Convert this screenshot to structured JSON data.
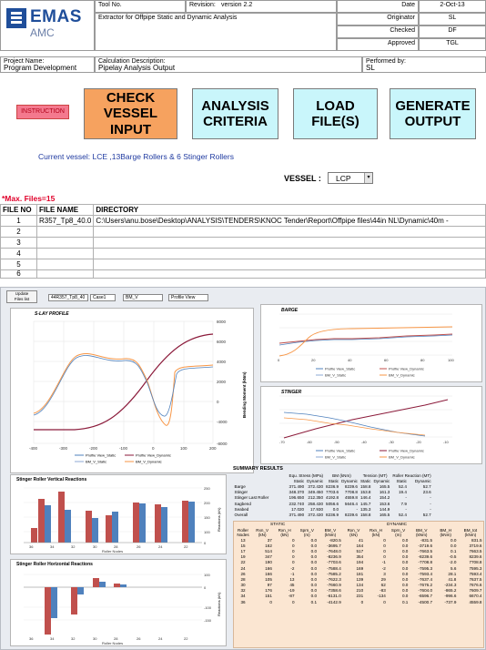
{
  "header": {
    "company": "EMAS",
    "company_sub": "AMC",
    "tool_no_label": "Tool No.",
    "tool_name": "Extractor for Offpipe Static and Dynamic Analysis",
    "revision_label": "Revision:",
    "revision_value": "version 2.2",
    "date_label": "Date",
    "date_value": "2-Oct-13",
    "originator_label": "Originator",
    "originator_value": "SL",
    "checked_label": "Checked",
    "checked_value": "DF",
    "approved_label": "Approved",
    "approved_value": "TGL",
    "project_label": "Project Name:",
    "project_value": "Program Development",
    "calc_label": "Calculation Description:",
    "calc_value": "Pipelay Analysis Output",
    "performed_label": "Performed by:",
    "performed_value": "SL"
  },
  "buttons": {
    "instruction": "INSTRUCTION",
    "check_vessel_line1": "CHECK",
    "check_vessel_line2": "VESSEL INPUT",
    "analysis_line1": "ANALYSIS",
    "analysis_line2": "CRITERIA",
    "load_files": "LOAD FILE(S)",
    "generate_line1": "GENERATE",
    "generate_line2": "OUTPUT"
  },
  "vessel": {
    "current": "Current vessel: LCE ,13Barge Rollers & 6 Stinger Rollers",
    "label": "VESSEL :",
    "value": "LCP"
  },
  "files": {
    "max_files": "*Max. Files=15",
    "col_no": "FILE NO",
    "col_name": "FILE NAME",
    "col_dir": "DIRECTORY",
    "rows": [
      {
        "no": "1",
        "name": "R357_Tp8_40.0",
        "dir": "C:\\Users\\anu.bose\\Desktop\\ANALYSIS\\TENDERS\\KNOC Tender\\Report\\Offpipe files\\44in NL\\Dynamic\\40m -"
      },
      {
        "no": "2",
        "name": "",
        "dir": ""
      },
      {
        "no": "3",
        "name": "",
        "dir": ""
      },
      {
        "no": "4",
        "name": "",
        "dir": ""
      },
      {
        "no": "5",
        "name": "",
        "dir": ""
      },
      {
        "no": "6",
        "name": "",
        "dir": ""
      }
    ]
  },
  "dashboard": {
    "update_btn_line1": "Update",
    "update_btn_line2": "Files list",
    "combo_file": "44R357_Tp8_40",
    "combo_case": "Case1",
    "combo_var": "BM_V",
    "combo_view": "Profile View",
    "slay_title": "S-LAY PROFILE",
    "slay_ylabel": "Bending Moment (kNm)",
    "barge_title": "BARGE",
    "stinger_title": "STINGER",
    "vert_title": "Stinger Roller Vertical Reactions",
    "horiz_title": "Stinger Roller Horizontal Reactions",
    "roller_nodes": "Roller Nodes",
    "reactions_kn": "Reactions (kN)",
    "legend_profile_static": "Profile View_Static",
    "legend_profile_dynamic": "Profile View_Dynamic",
    "legend_bm_static": "BM_V_Static",
    "legend_bm_dynamic": "BM_V_Dynamic",
    "summary_title": "SUMMARY RESULTS"
  },
  "summary": {
    "headers": [
      "",
      "Equ. Stress (MPa)",
      "BM (kNm)",
      "Tension (MT)",
      "Roller Reaction (MT)"
    ],
    "sub": [
      "",
      "Static",
      "Dynamic",
      "Static",
      "Dynamic",
      "Static",
      "Dynamic",
      "Static",
      "Dynamic"
    ],
    "rows": [
      [
        "Barge",
        "371.490",
        "372.430",
        "8236.9",
        "8239.6",
        "158.8",
        "165.5",
        "52.4",
        "52.7"
      ],
      [
        "Stinger",
        "348.370",
        "349.450",
        "7703.6",
        "7708.8",
        "153.8",
        "161.3",
        "19.4",
        "23.6"
      ],
      [
        "Stinger Last Roller",
        "196.650",
        "212.350",
        "4192.8",
        "4559.8",
        "146.4",
        "154.2",
        "-",
        "-"
      ],
      [
        "Sagbend",
        "232.740",
        "258.430",
        "5056.6",
        "5646.4",
        "145.7",
        "153.6",
        "7.9",
        "-"
      ],
      [
        "Seabed",
        "17.020",
        "17.930",
        "0.0",
        "-",
        "135.3",
        "144.9",
        "-",
        "-"
      ],
      [
        "Overall",
        "371.490",
        "372.430",
        "8236.9",
        "8239.6",
        "158.8",
        "165.5",
        "52.4",
        "52.7"
      ]
    ]
  },
  "reactions": {
    "group_static": "STATIC",
    "group_dynamic": "DYNAMIC",
    "headers": [
      "Roller Nodes",
      "Rxn_V (kN)",
      "Rxn_H (kN)",
      "Sprn_V (m)",
      "BM_V (kNm)",
      "Rxn_V (kN)",
      "Rxn_H (kN)",
      "Sprn_V (m)",
      "BM_V (kNm)",
      "BM_H (kNm)",
      "BM_tot (kNm)"
    ],
    "rows": [
      [
        "13",
        "37",
        "0",
        "0.0",
        "-820.5",
        "41",
        "0",
        "0.0",
        "-831.5",
        "0.0",
        "831.5"
      ],
      [
        "15",
        "162",
        "0",
        "0.0",
        "-3695.7",
        "164",
        "0",
        "0.0",
        "-3719.6",
        "0.0",
        "3719.6"
      ],
      [
        "17",
        "514",
        "0",
        "0.0",
        "-7648.0",
        "517",
        "0",
        "0.0",
        "-7663.5",
        "0.1",
        "7663.5"
      ],
      [
        "19",
        "347",
        "0",
        "0.0",
        "-8236.9",
        "354",
        "0",
        "0.0",
        "-8239.6",
        "-0.5",
        "8239.6"
      ],
      [
        "22",
        "190",
        "0",
        "0.0",
        "-7703.6",
        "194",
        "-1",
        "0.0",
        "-7708.8",
        "-2.0",
        "7708.8"
      ],
      [
        "24",
        "166",
        "-2",
        "0.0",
        "-7588.4",
        "169",
        "-2",
        "0.0",
        "-7595.3",
        "5.6",
        "7595.3"
      ],
      [
        "26",
        "166",
        "-1",
        "0.0",
        "-7585.2",
        "181",
        "3",
        "0.0",
        "-7593.4",
        "28.1",
        "7593.4"
      ],
      [
        "28",
        "105",
        "13",
        "0.0",
        "-7622.3",
        "139",
        "29",
        "0.0",
        "-7637.4",
        "41.8",
        "7637.5"
      ],
      [
        "30",
        "97",
        "45",
        "0.0",
        "-7660.9",
        "134",
        "62",
        "0.0",
        "-7676.2",
        "-234.3",
        "7676.6"
      ],
      [
        "32",
        "176",
        "-19",
        "0.0",
        "-7358.6",
        "210",
        "-83",
        "0.0",
        "-7604.0",
        "-865.2",
        "7609.7"
      ],
      [
        "34",
        "151",
        "-87",
        "0.0",
        "-6131.0",
        "231",
        "-134",
        "0.0",
        "-6596.7",
        "-996.6",
        "6670.4"
      ],
      [
        "36",
        "0",
        "0",
        "0.1",
        "-4142.9",
        "0",
        "0",
        "0.1",
        "-4500.7",
        "-737.9",
        "4559.8"
      ]
    ]
  },
  "colors": {
    "brand": "#1f4e9a",
    "instruction_bg": "#f4798e",
    "btn_cyan": "#c9f6fb",
    "btn_orange": "#f6a25f",
    "static_line": "#4f81bd",
    "dynamic_line": "#c0504d",
    "bm_static": "#8da9d4",
    "bm_dynamic": "#f79646",
    "profile_red": "#8b1a3a"
  }
}
